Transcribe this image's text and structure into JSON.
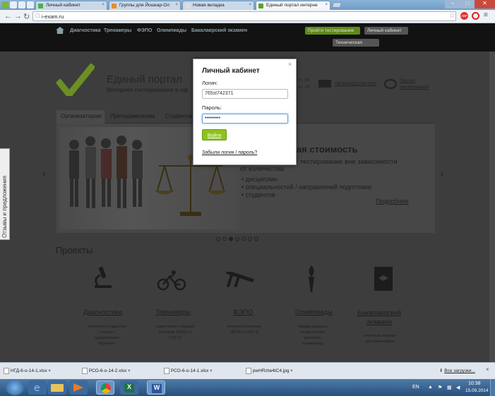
{
  "browser": {
    "tabs": [
      {
        "label": "Личный кабинет"
      },
      {
        "label": "Группы для Йошкар-Ол"
      },
      {
        "label": "Новая вкладка"
      },
      {
        "label": "Единый портал интерне"
      }
    ],
    "url": "i-exam.ru",
    "badge_abp": "ABP"
  },
  "site": {
    "menu": [
      "Диагностика",
      "Тренажеры",
      "ФЭПО",
      "Олимпиады",
      "Бакалаврский экзамен"
    ],
    "btn_green": "Пройти тестирование",
    "btn_cabinet": "Личный кабинет",
    "btn_tech": "Техническая"
  },
  "header": {
    "title": "Единый портал",
    "subtitle": "Интернет-тестирования в сф",
    "email": "ukr.bulo@gmail.com",
    "phone_a": "ru_88",
    "phone_b": "ru_24",
    "portal_link": "Портал тестирования"
  },
  "subtabs": [
    "Организатором",
    "Преподавателем",
    "Студентом"
  ],
  "banner": {
    "heading": "ая стоимость",
    "line1": "тестирование вне зависимости",
    "line2": "от количества",
    "bullets": [
      "дисциплин",
      "специальностей / направлений подготовки",
      "студентов"
    ],
    "more": "Подробнее"
  },
  "side_tab": "Отзывы и предложения",
  "projects": {
    "title": "Проекты",
    "items": [
      {
        "name": "Диагностика",
        "desc": "готовность студентов 1 курса к продолжению обучения"
      },
      {
        "name": "Тренажеры",
        "desc": "подготовка к текущей контроль (ФГОС и ГОС-2)"
      },
      {
        "name": "ФЭПО",
        "desc": "итоговый контроль (ФГОС и ГОС-2)"
      },
      {
        "name": "Олимпиады",
        "desc": "международные студенческие интернет-олимпиады"
      },
      {
        "name": "Бакалаврский экзамен",
        "desc": "итоговый экзамен для бакалавров"
      }
    ]
  },
  "modal": {
    "title": "Личный кабинет",
    "login_label": "Логин:",
    "login_value": "765st742371",
    "password_label": "Пароль:",
    "password_value": "•••••••••",
    "submit": "Войти",
    "forgot": "Забыли логин / пароль?",
    "close": "×"
  },
  "downloads": {
    "items": [
      "НГД-6-о-14-1.xlsx",
      "РСО-6-о-14-2.xlsx",
      "РСО-6-о-14-1.xlsx",
      "pwHRztw4tC4.jpg"
    ],
    "all": "Все загрузки..."
  },
  "taskbar": {
    "lang": "EN",
    "time": "10:38",
    "date": "15.09.2014"
  },
  "colors": {
    "accent_green": "#7fbf1a",
    "check_green": "#8bbf2a",
    "page_dark": "#3d3d3d",
    "header_black": "#121212",
    "taskbar_blue": "#3a6597"
  }
}
